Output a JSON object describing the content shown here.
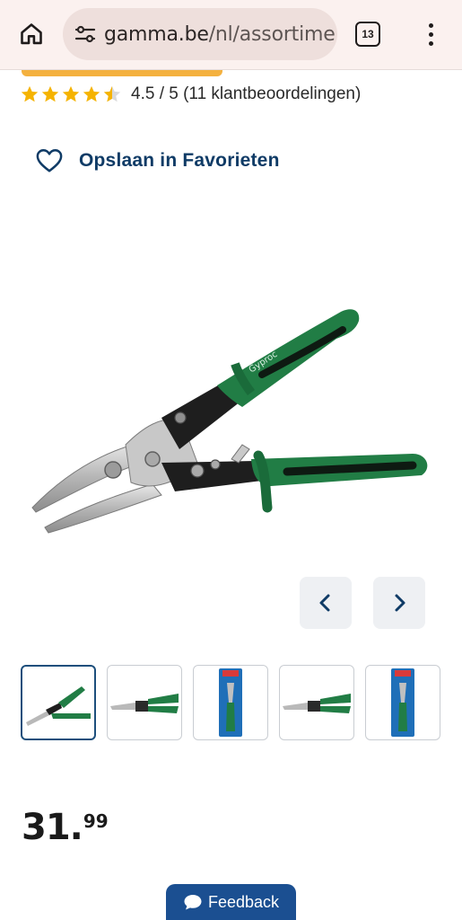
{
  "browser": {
    "url_host": "gamma.be",
    "url_path": "/nl/assortime",
    "tab_count": "13",
    "icons": [
      "home-icon",
      "site-settings-icon",
      "tab-switcher-icon",
      "overflow-menu-icon"
    ]
  },
  "colors": {
    "accent_blue": "#0f3b66",
    "star": "#f5b301",
    "orange_strip": "#f4b13f",
    "feedback_bg": "#1b4f91",
    "chrome_bg": "#fbf1ef"
  },
  "product": {
    "rating_value": 4.5,
    "rating_text": "4.5 / 5 (11 klantbeoordelingen)",
    "favorite_label": "Opslaan in Favorieten",
    "brand_on_handle": "Gyproc",
    "price_main": "31.",
    "price_cents": "99",
    "thumbnails": [
      {
        "kind": "side-view-green",
        "selected": true
      },
      {
        "kind": "front-view",
        "selected": false
      },
      {
        "kind": "packaging",
        "selected": false
      },
      {
        "kind": "front-view",
        "selected": false
      },
      {
        "kind": "packaging",
        "selected": false
      }
    ]
  },
  "feedback": {
    "label": "Feedback"
  }
}
